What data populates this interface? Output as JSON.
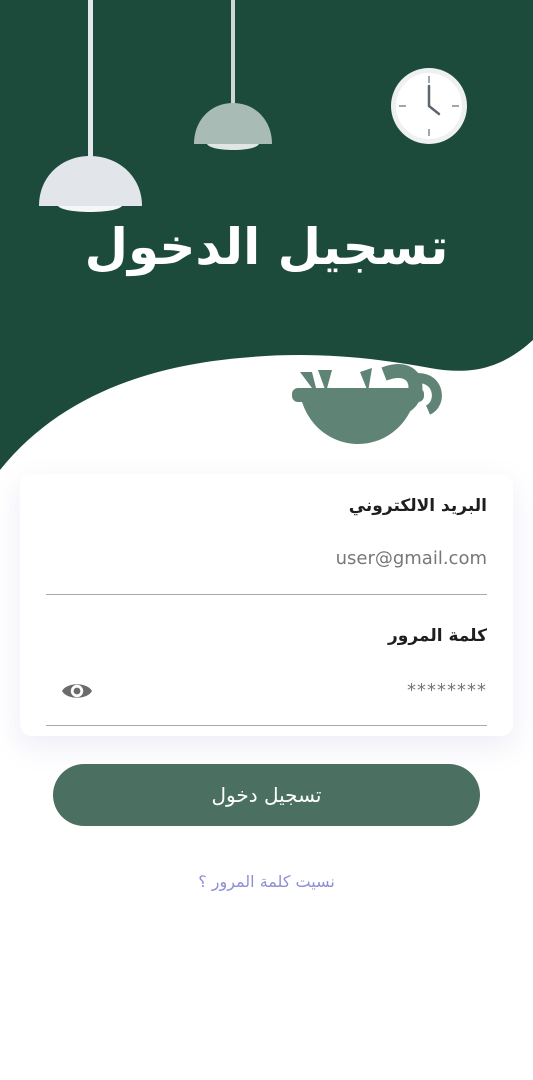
{
  "header": {
    "title": "تسجيل الدخول"
  },
  "form": {
    "email_label": "البريد الالكتروني",
    "email_value": "user@gmail.com",
    "password_label": "كلمة المرور",
    "password_value": "********"
  },
  "actions": {
    "login_label": "تسجيل دخول",
    "forgot_label": "نسيت كلمة المرور ؟"
  },
  "colors": {
    "hero_green": "#1c4b3c",
    "button_green": "#4b7062",
    "link": "#8d8fd6"
  },
  "icons": {
    "visibility": "eye-icon",
    "clock": "clock-icon",
    "lamp": "pendant-lamp-icon",
    "plant": "plant-pot-icon"
  }
}
